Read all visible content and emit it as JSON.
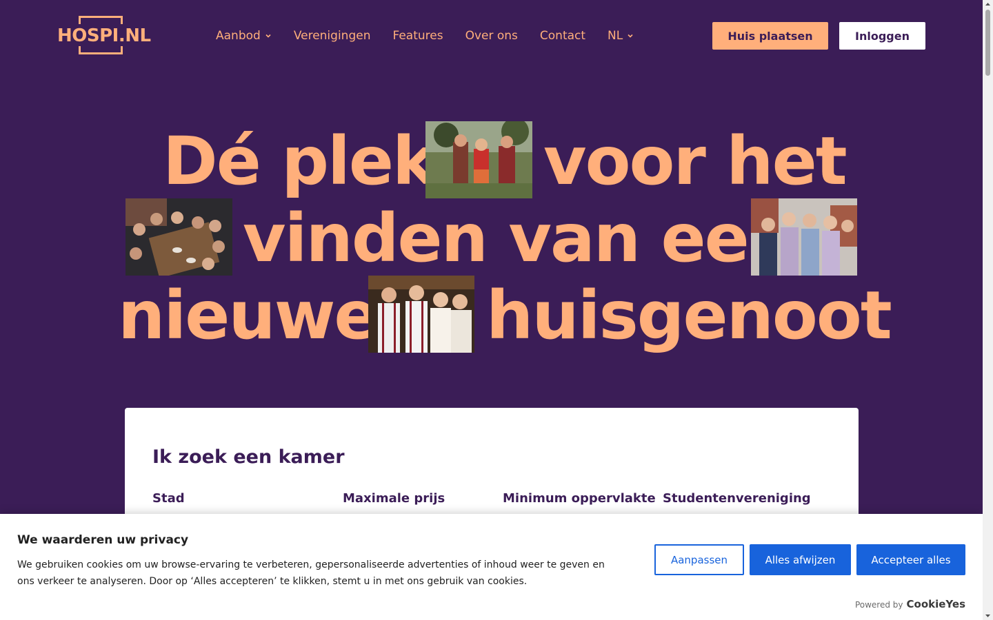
{
  "header": {
    "logo_text": "HOSPI.NL",
    "nav": [
      {
        "label": "Aanbod",
        "has_dropdown": true
      },
      {
        "label": "Verenigingen",
        "has_dropdown": false
      },
      {
        "label": "Features",
        "has_dropdown": false
      },
      {
        "label": "Over ons",
        "has_dropdown": false
      },
      {
        "label": "Contact",
        "has_dropdown": false
      },
      {
        "label": "NL",
        "has_dropdown": true
      }
    ],
    "place_button": "Huis plaatsen",
    "login_button": "Inloggen"
  },
  "hero": {
    "line1_left": "Dé plek",
    "line1_right": "voor het",
    "line2": "vinden van een",
    "line3_left": "nieuwe",
    "line3_right": "huisgenoot",
    "photos": [
      "festival-photo",
      "dinner-photo",
      "friends-photo",
      "party-photo"
    ]
  },
  "search": {
    "title": "Ik zoek een kamer",
    "filters": [
      "Stad",
      "Maximale prijs",
      "Minimum oppervlakte",
      "Studentenvereniging"
    ]
  },
  "cookie": {
    "title": "We waarderen uw privacy",
    "text": "We gebruiken cookies om uw browse-ervaring te verbeteren, gepersonaliseerde advertenties of inhoud weer te geven en ons verkeer te analyseren. Door op ‘Alles accepteren’ te klikken, stemt u in met ons gebruik van cookies.",
    "customize": "Aanpassen",
    "reject": "Alles afwijzen",
    "accept": "Accepteer alles",
    "powered_label": "Powered by",
    "powered_brand": "CookieYes"
  },
  "colors": {
    "background": "#3b1d57",
    "accent": "#ffaf7b",
    "cookie_blue": "#1863dc"
  }
}
